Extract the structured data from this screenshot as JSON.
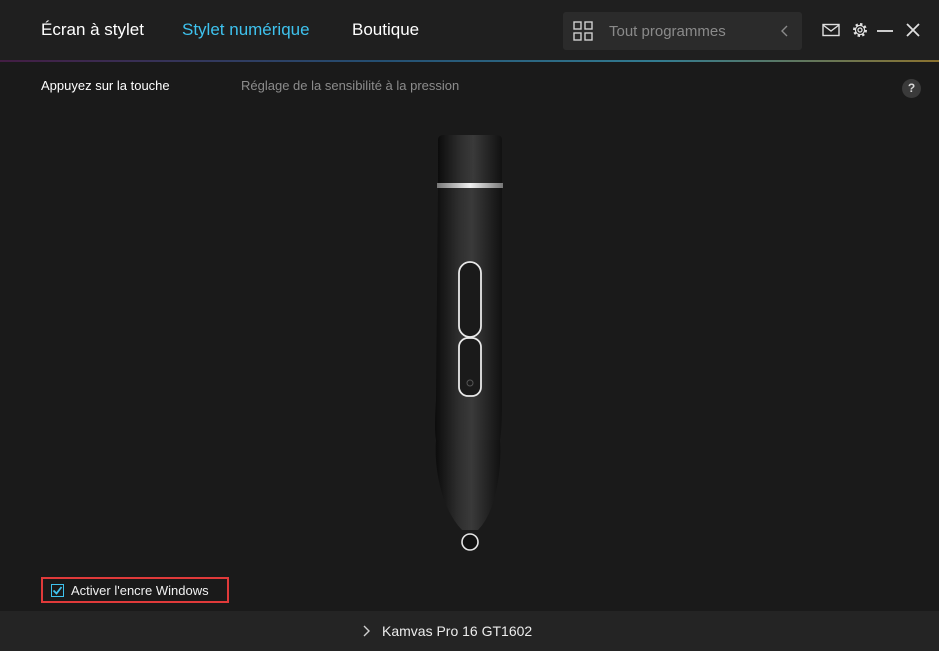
{
  "header": {
    "tabs": [
      {
        "label": "Écran à stylet",
        "active": false
      },
      {
        "label": "Stylet numérique",
        "active": true
      },
      {
        "label": "Boutique",
        "active": false
      }
    ],
    "search": {
      "placeholder": "Tout programmes"
    },
    "icons": [
      "grid-icon",
      "chevron-left-icon",
      "mail-icon",
      "gear-icon",
      "minimize-icon",
      "close-icon"
    ]
  },
  "subtabs": [
    {
      "label": "Appuyez sur la touche",
      "active": true
    },
    {
      "label": "Réglage de la sensibilité à la pression",
      "active": false
    }
  ],
  "help_label": "?",
  "ink_option": {
    "label": "Activer l'encre Windows",
    "checked": true
  },
  "footer": {
    "device_name": "Kamvas Pro 16 GT1602"
  },
  "colors": {
    "accent": "#3ec2ee",
    "background": "#1a1a1a",
    "highlight_border": "#e03a3a"
  }
}
